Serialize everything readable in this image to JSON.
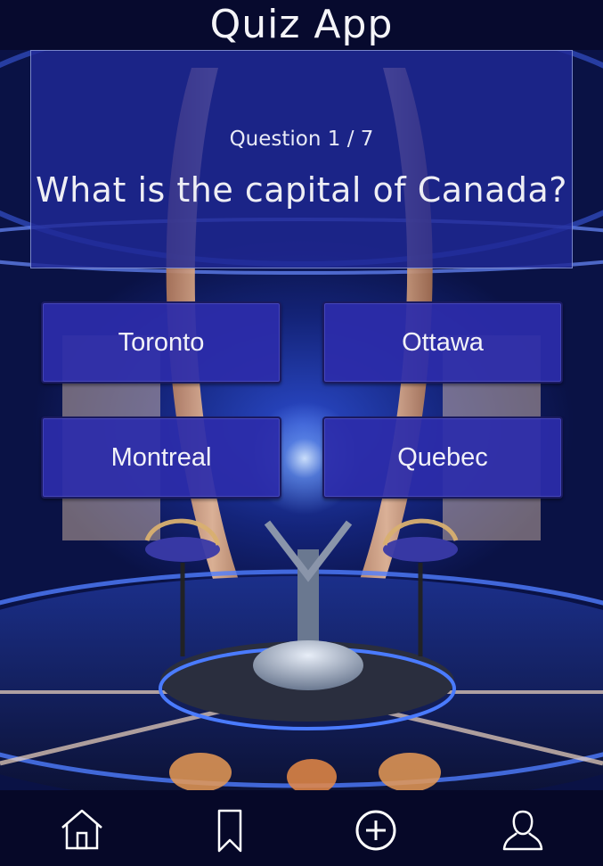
{
  "header": {
    "title": "Quiz App"
  },
  "quiz": {
    "counter": "Question 1 / 7",
    "question": "What is the capital of Canada?",
    "answers": [
      "Toronto",
      "Ottawa",
      "Montreal",
      "Quebec"
    ]
  },
  "nav": {
    "items": [
      {
        "icon": "home-icon"
      },
      {
        "icon": "bookmark-icon"
      },
      {
        "icon": "plus-circle-icon"
      },
      {
        "icon": "user-icon"
      }
    ]
  },
  "colors": {
    "header_bg": "#070a2e",
    "question_bg": "#2028a0",
    "answer_bg": "#2c2caa",
    "nav_bg": "#060828",
    "text": "#f2f2f8"
  }
}
